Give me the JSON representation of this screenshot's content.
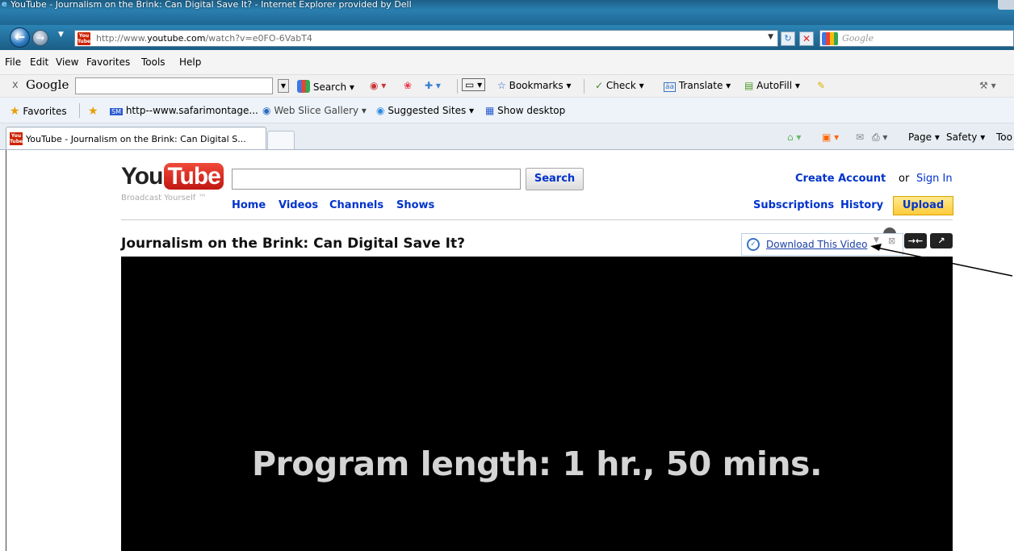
{
  "window": {
    "title": "YouTube - Journalism on the Brink: Can Digital Save It? - Internet Explorer provided by Dell"
  },
  "address_bar": {
    "url_prefix": "http://www.",
    "url_domain": "youtube.com",
    "url_path": "/watch?v=e0FO-6VabT4",
    "search_placeholder": "Google"
  },
  "menu": [
    "File",
    "Edit",
    "View",
    "Favorites",
    "Tools",
    "Help"
  ],
  "google_toolbar": {
    "close": "x",
    "logo": "Google",
    "search_label": "Search",
    "bookmarks_label": "Bookmarks",
    "check_label": "Check",
    "translate_label": "Translate",
    "autofill_label": "AutoFill"
  },
  "favorites_bar": {
    "favorites_label": "Favorites",
    "link1": "http--www.safarimontage...",
    "link2": "Web Slice Gallery",
    "link3": "Suggested Sites",
    "link4": "Show desktop"
  },
  "tabs": {
    "active_title": "YouTube - Journalism on the Brink: Can Digital S...",
    "page_label": "Page",
    "safety_label": "Safety",
    "tools_label": "Too"
  },
  "youtube": {
    "logo_you": "You",
    "logo_tube": "Tube",
    "tagline": "Broadcast Yourself ™",
    "search_button": "Search",
    "nav": [
      "Home",
      "Videos",
      "Channels",
      "Shows"
    ],
    "create_account": "Create Account",
    "or": "or",
    "sign_in": "Sign In",
    "subscriptions": "Subscriptions",
    "history": "History",
    "upload": "Upload",
    "video_title": "Journalism on the Brink: Can Digital Save It?",
    "download_label": "Download This Video",
    "player_message": "Program length: 1 hr., 50 mins."
  },
  "colors": {
    "link_blue": "#0033cc",
    "upload_yellow": "#ffcb3a",
    "ie_blue": "#2a7fb0"
  }
}
